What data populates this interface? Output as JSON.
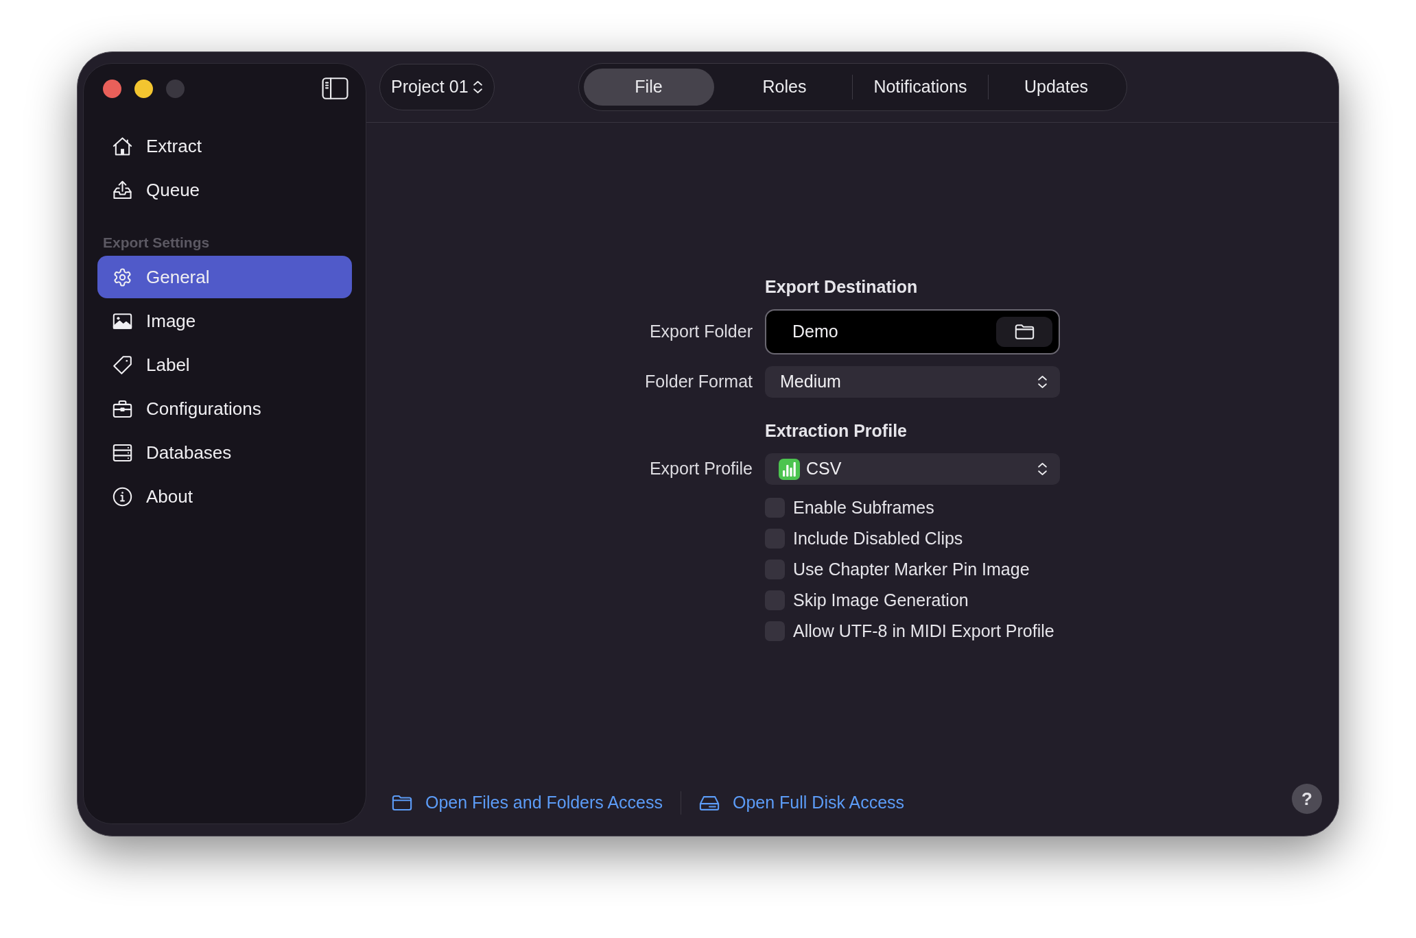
{
  "project_selector": {
    "value": "Project 01"
  },
  "tabs": [
    {
      "label": "File",
      "selected": true
    },
    {
      "label": "Roles",
      "selected": false
    },
    {
      "label": "Notifications",
      "selected": false
    },
    {
      "label": "Updates",
      "selected": false
    }
  ],
  "sidebar": {
    "groups": [
      {
        "items": [
          {
            "label": "Extract",
            "selected": false
          },
          {
            "label": "Queue",
            "selected": false
          }
        ]
      },
      {
        "title": "Export Settings",
        "items": [
          {
            "label": "General",
            "selected": true
          },
          {
            "label": "Image",
            "selected": false
          },
          {
            "label": "Label",
            "selected": false
          },
          {
            "label": "Configurations",
            "selected": false
          },
          {
            "label": "Databases",
            "selected": false
          },
          {
            "label": "About",
            "selected": false
          }
        ]
      }
    ]
  },
  "sections": [
    {
      "title": "Export Destination",
      "fields": [
        {
          "kind": "folder",
          "label": "Export Folder",
          "value": "Demo"
        },
        {
          "kind": "select",
          "label": "Folder Format",
          "value": "Medium"
        }
      ]
    },
    {
      "title": "Extraction Profile",
      "fields": [
        {
          "kind": "profile",
          "label": "Export Profile",
          "value": "CSV"
        },
        {
          "kind": "checkbox",
          "label": "Enable Subframes",
          "checked": false
        },
        {
          "kind": "checkbox",
          "label": "Include Disabled Clips",
          "checked": false
        },
        {
          "kind": "checkbox",
          "label": "Use Chapter Marker Pin Image",
          "checked": false
        },
        {
          "kind": "checkbox",
          "label": "Skip Image Generation",
          "checked": false
        },
        {
          "kind": "checkbox",
          "label": "Allow UTF-8 in MIDI Export Profile",
          "checked": false
        }
      ]
    }
  ],
  "footer_links": [
    {
      "label": "Open Files and Folders Access"
    },
    {
      "label": "Open Full Disk Access"
    }
  ],
  "help_button": {
    "label": "?"
  }
}
